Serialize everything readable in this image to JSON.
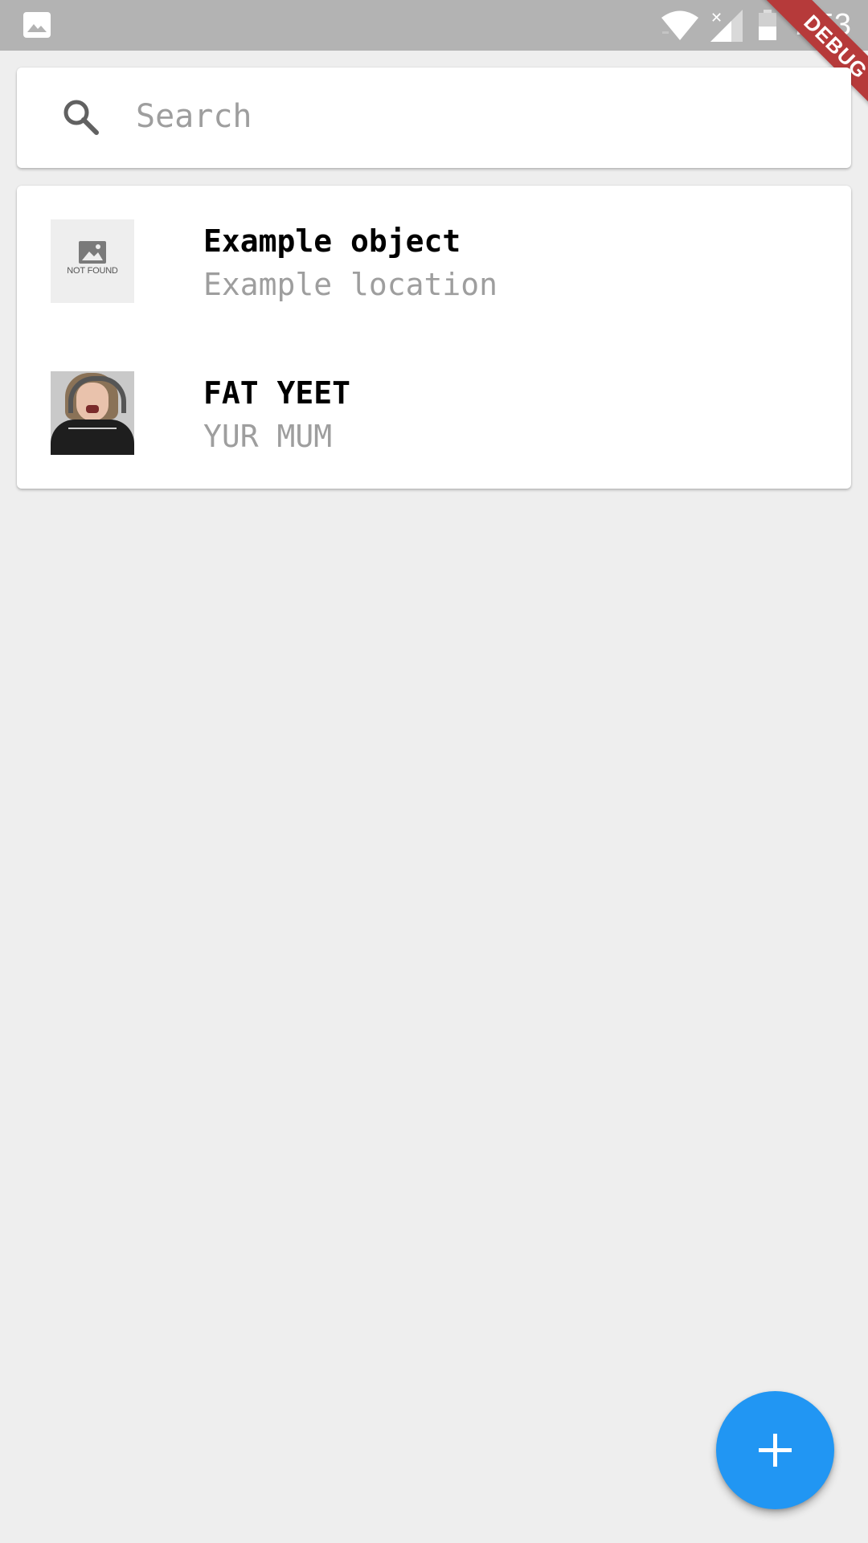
{
  "status_bar": {
    "time": "7:53",
    "icons": [
      "gallery-icon",
      "wifi-icon",
      "signal-icon",
      "battery-icon"
    ]
  },
  "debug_banner": {
    "label": "DEBUG",
    "color": "#b63a3a"
  },
  "search": {
    "placeholder": "Search",
    "value": ""
  },
  "items": [
    {
      "title": "Example object",
      "subtitle": "Example location",
      "thumbnail": "not-found-image",
      "thumbnail_text": "NOT FOUND"
    },
    {
      "title": "FAT YEET",
      "subtitle": "YUR MUM",
      "thumbnail": "photo"
    }
  ],
  "fab": {
    "icon": "plus-icon",
    "color": "#2196f3"
  },
  "colors": {
    "background": "#eeeeee",
    "card": "#ffffff",
    "status_bar": "#b3b3b3",
    "subtitle": "#9e9e9e"
  }
}
